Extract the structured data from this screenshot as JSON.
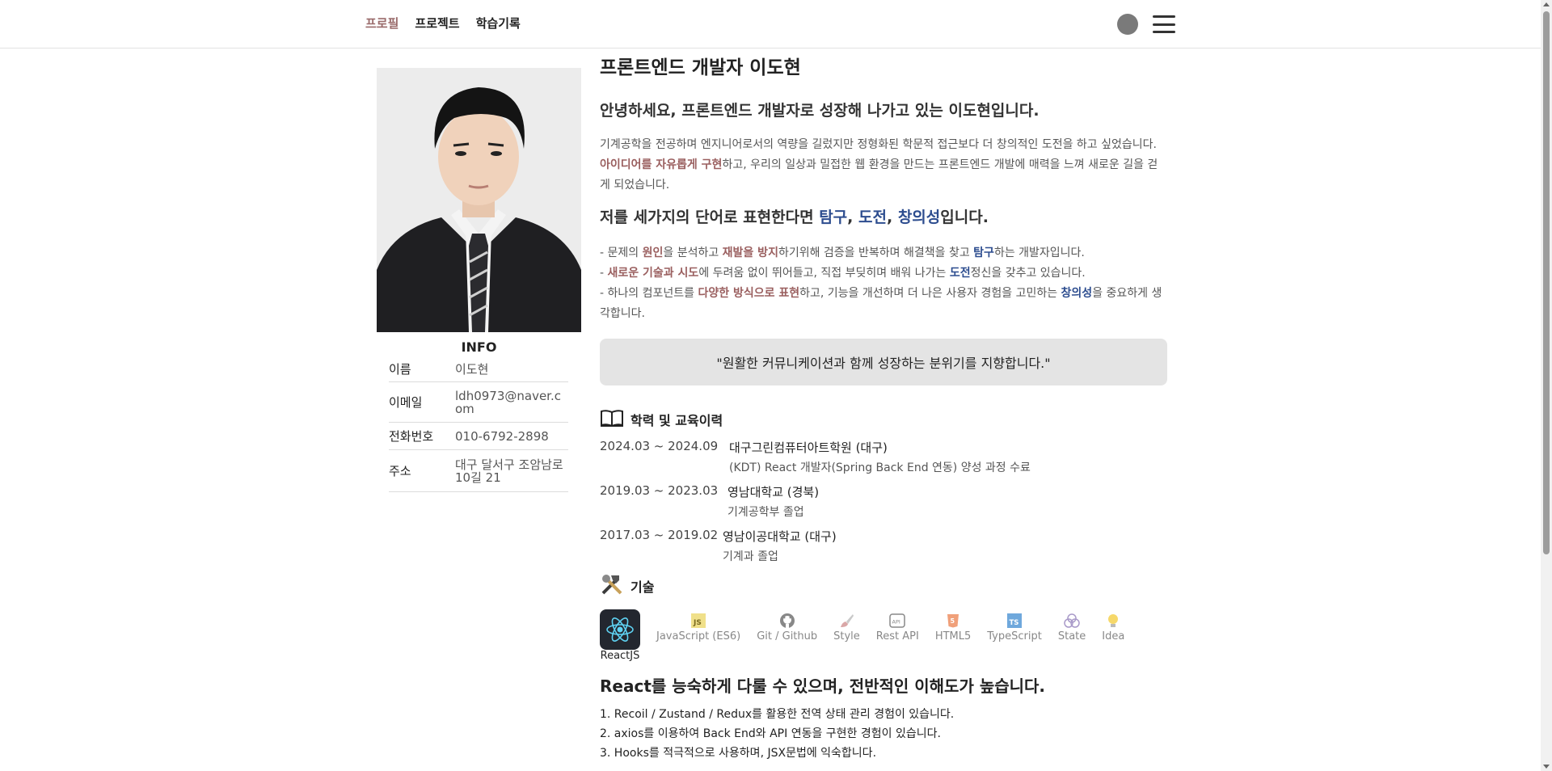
{
  "nav": {
    "items": [
      {
        "label": "프로필",
        "active": true
      },
      {
        "label": "프로젝트",
        "active": false
      },
      {
        "label": "학습기록",
        "active": false
      }
    ]
  },
  "info": {
    "title": "INFO",
    "rows": [
      {
        "key": "이름",
        "value": "이도현"
      },
      {
        "key": "이메일",
        "value": "ldh0973@naver.com"
      },
      {
        "key": "전화번호",
        "value": "010-6792-2898"
      },
      {
        "key": "주소",
        "value": "대구 달서구 조암남로 10길 21"
      }
    ]
  },
  "profile": {
    "title": "프론트엔드 개발자 이도현",
    "greeting": "안녕하세요, 프론트엔드 개발자로 성장해 나가고 있는 이도현입니다.",
    "intro": {
      "p1": "기계공학을 전공하며 엔지니어로서의 역량을 길렀지만 정형화된 학문적 접근보다 더 창의적인 도전을 하고 싶었습니다. ",
      "em1": "아이디어를 자유롭게 구현",
      "p2": "하고, 우리의 일상과 밀접한 웹 환경을 만드는 프론트엔드 개발에 매력을 느껴 새로운 길을 걷게 되었습니다."
    },
    "keywords": {
      "prefix": "저를 세가지의 단어로 표현한다면 ",
      "k1": "탐구",
      "sep1": ", ",
      "k2": "도전",
      "sep2": ", ",
      "k3": "창의성",
      "suffix": "입니다."
    },
    "bullets": {
      "b1": {
        "a": "- 문제의 ",
        "e1": "원인",
        "b": "을 분석하고 ",
        "e2": "재발을 방지",
        "c": "하기위해 검증을 반복하며 해결책을 찾고 ",
        "e3": "탐구",
        "d": "하는 개발자입니다."
      },
      "b2": {
        "a": "- ",
        "e1": "새로운 기술과 시도",
        "b": "에 두려움 없이 뛰어들고, 직접 부딪히며 배워 나가는 ",
        "e2": "도전",
        "c": "정신을 갖추고 있습니다."
      },
      "b3": {
        "a": "- 하나의 컴포넌트를 ",
        "e1": "다양한 방식으로 표현",
        "b": "하고, 기능을 개선하며 더 나은 사용자 경험을 고민하는 ",
        "e2": "창의성",
        "c": "을 중요하게 생각합니다."
      }
    },
    "quote": "\"원활한 커뮤니케이션과 함께 성장하는 분위기를 지향합니다.\""
  },
  "education": {
    "title": "학력 및 교육이력",
    "items": [
      {
        "date": "2024.03 ~ 2024.09",
        "school": "대구그린컴퓨터아트학원 (대구)",
        "detail": "(KDT) React 개발자(Spring Back End 연동) 양성 과정 수료"
      },
      {
        "date": "2019.03 ~ 2023.03",
        "school": "영남대학교 (경북)",
        "detail": "기계공학부 졸업"
      },
      {
        "date": "2017.03 ~ 2019.02",
        "school": "영남이공대학교 (대구)",
        "detail": "기계과 졸업"
      }
    ]
  },
  "skills": {
    "title": "기술",
    "tabs": [
      {
        "label": "ReactJS",
        "icon": "react-icon"
      },
      {
        "label": "JavaScript (ES6)",
        "icon": "javascript-icon"
      },
      {
        "label": "Git / Github",
        "icon": "github-icon"
      },
      {
        "label": "Style",
        "icon": "style-icon"
      },
      {
        "label": "Rest API",
        "icon": "api-icon"
      },
      {
        "label": "HTML5",
        "icon": "html5-icon"
      },
      {
        "label": "TypeScript",
        "icon": "typescript-icon"
      },
      {
        "label": "State",
        "icon": "state-icon"
      },
      {
        "label": "Idea",
        "icon": "idea-icon"
      }
    ],
    "heading": "React를 능숙하게 다룰 수 있으며, 전반적인 이해도가 높습니다.",
    "list": [
      "1. Recoil / Zustand / Redux를 활용한 전역 상태 관리 경험이 있습니다.",
      "2. axios를 이용하여 Back End와 API 연동을 구현한 경험이 있습니다.",
      "3. Hooks를 적극적으로 사용하며, JSX문법에 익숙합니다."
    ]
  },
  "colors": {
    "accent_red": "#9a5f5f",
    "accent_blue": "#2d4d8f",
    "quote_bg": "#e4e4e4"
  }
}
